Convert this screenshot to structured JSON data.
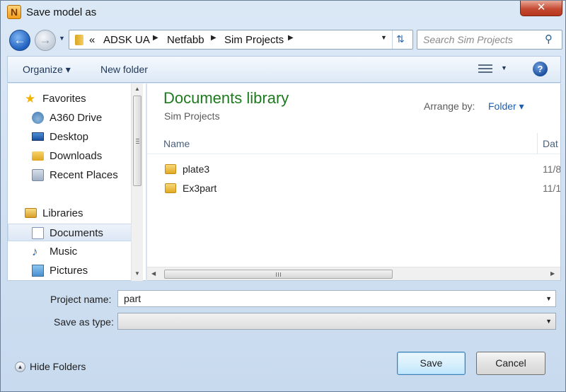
{
  "window": {
    "app_icon_letter": "N",
    "title": "Save model as",
    "close_glyph": "✕"
  },
  "navigation": {
    "back_glyph": "←",
    "forward_glyph": "→",
    "breadcrumb_overflow": "«",
    "breadcrumbs": [
      "ADSK UA",
      "Netfabb",
      "Sim Projects"
    ],
    "search": {
      "placeholder": "Search Sim Projects"
    }
  },
  "toolbar": {
    "organize_label": "Organize ▾",
    "new_folder_label": "New folder",
    "help_glyph": "?"
  },
  "sidebar": {
    "items": [
      {
        "label": "Favorites",
        "icon": "star-icon"
      },
      {
        "label": "A360 Drive",
        "icon": "cloud-drive-icon"
      },
      {
        "label": "Desktop",
        "icon": "desktop-icon"
      },
      {
        "label": "Downloads",
        "icon": "downloads-folder-icon"
      },
      {
        "label": "Recent Places",
        "icon": "recent-places-icon"
      },
      {
        "label": "Libraries",
        "icon": "libraries-icon"
      },
      {
        "label": "Documents",
        "icon": "documents-icon",
        "selected": true
      },
      {
        "label": "Music",
        "icon": "music-icon"
      },
      {
        "label": "Pictures",
        "icon": "pictures-icon"
      }
    ]
  },
  "content": {
    "library_title": "Documents library",
    "library_subtitle": "Sim Projects",
    "arrange_by_label": "Arrange by:",
    "arrange_by_value": "Folder ▾",
    "columns": [
      "Name",
      "Dat"
    ],
    "files": [
      {
        "name": "plate3",
        "date": "11/8"
      },
      {
        "name": "Ex3part",
        "date": "11/1"
      }
    ]
  },
  "form": {
    "project_name_label": "Project name:",
    "project_name_value": "part",
    "save_as_type_label": "Save as type:",
    "save_as_type_value": ""
  },
  "footer": {
    "hide_folders_label": "Hide Folders",
    "save_label": "Save",
    "cancel_label": "Cancel"
  },
  "colors": {
    "library_title": "#1e7a1e",
    "link_blue": "#1f5fad",
    "close_red": "#c44a32"
  }
}
